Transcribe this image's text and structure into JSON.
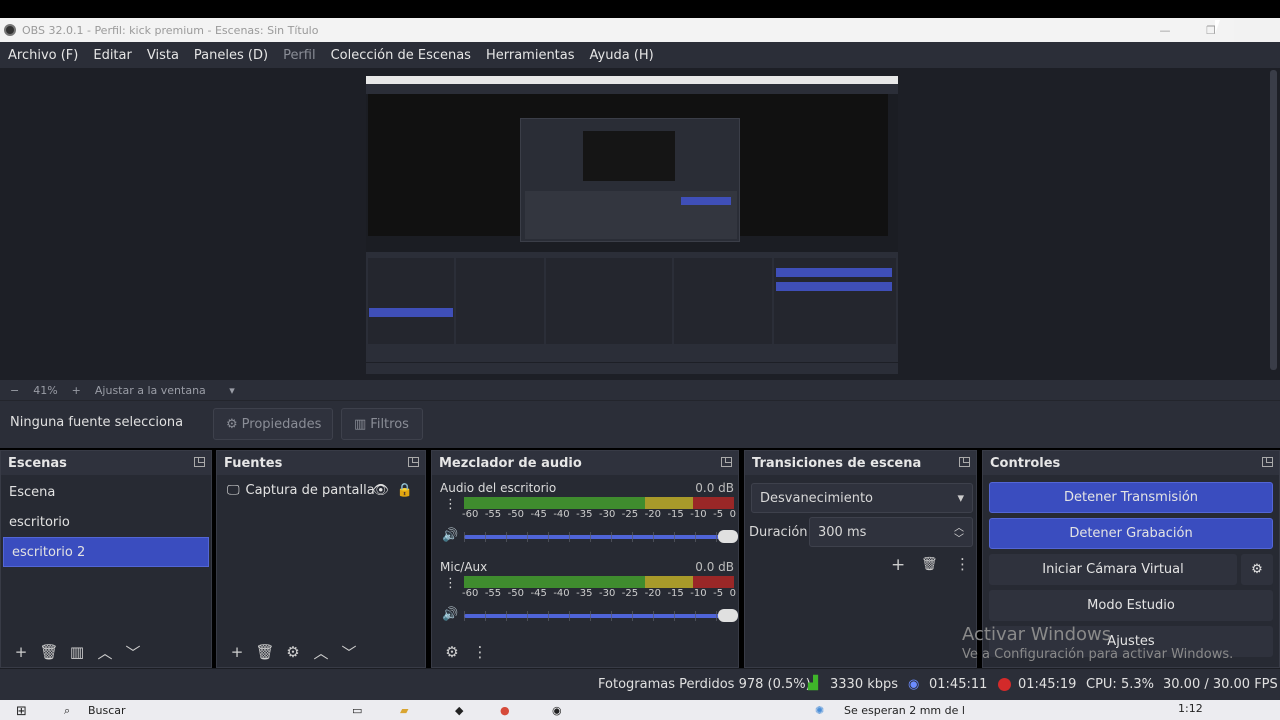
{
  "window": {
    "title": "OBS 32.0.1 - Perfil: kick premium - Escenas: Sin Título"
  },
  "menu": [
    "Archivo (F)",
    "Editar",
    "Vista",
    "Paneles (D)",
    "Perfil",
    "Colección de Escenas",
    "Herramientas",
    "Ayuda (H)"
  ],
  "zoom": {
    "minus": "−",
    "value": "41%",
    "plus": "+",
    "fit": "Ajustar a la ventana"
  },
  "source_toolbar": {
    "label": "Ninguna fuente selecciona",
    "properties": "Propiedades",
    "filters": "Filtros"
  },
  "scenes": {
    "title": "Escenas",
    "items": [
      "Escena",
      "escritorio",
      "escritorio 2"
    ],
    "selected_index": 2
  },
  "sources": {
    "title": "Fuentes",
    "items": [
      "Captura de pantalla"
    ]
  },
  "mixer": {
    "title": "Mezclador de audio",
    "tracks": [
      {
        "name": "Audio del escritorio",
        "db": "0.0 dB"
      },
      {
        "name": "Mic/Aux",
        "db": "0.0 dB"
      }
    ],
    "scale": [
      "-60",
      "-55",
      "-50",
      "-45",
      "-40",
      "-35",
      "-30",
      "-25",
      "-20",
      "-15",
      "-10",
      "-5",
      "0"
    ]
  },
  "transitions": {
    "title": "Transiciones de escena",
    "selected": "Desvanecimiento",
    "duration_label": "Duración",
    "duration_value": "300 ms"
  },
  "controls": {
    "title": "Controles",
    "stop_stream": "Detener Transmisión",
    "stop_record": "Detener Grabación",
    "virtual_cam": "Iniciar Cámara Virtual",
    "studio_mode": "Modo Estudio",
    "settings": "Ajustes"
  },
  "watermark": {
    "line1": "Activar Windows",
    "line2": "Ve a Configuración para activar Windows."
  },
  "status": {
    "dropped": "Fotogramas Perdidos 978 (0.5%)",
    "bitrate": "3330 kbps",
    "stream_time": "01:45:11",
    "rec_time": "01:45:19",
    "cpu": "CPU: 5.3%",
    "fps": "30.00 / 30.00 FPS"
  },
  "taskbar": {
    "search": "Buscar",
    "notice": "Se esperan 2 mm de l",
    "clock": "1:12"
  },
  "colors": {
    "accent": "#3a4dbf",
    "panel": "#272a33",
    "bar": "#2b2e38",
    "rec": "#d32a2a",
    "signal": "#3fb52a"
  }
}
